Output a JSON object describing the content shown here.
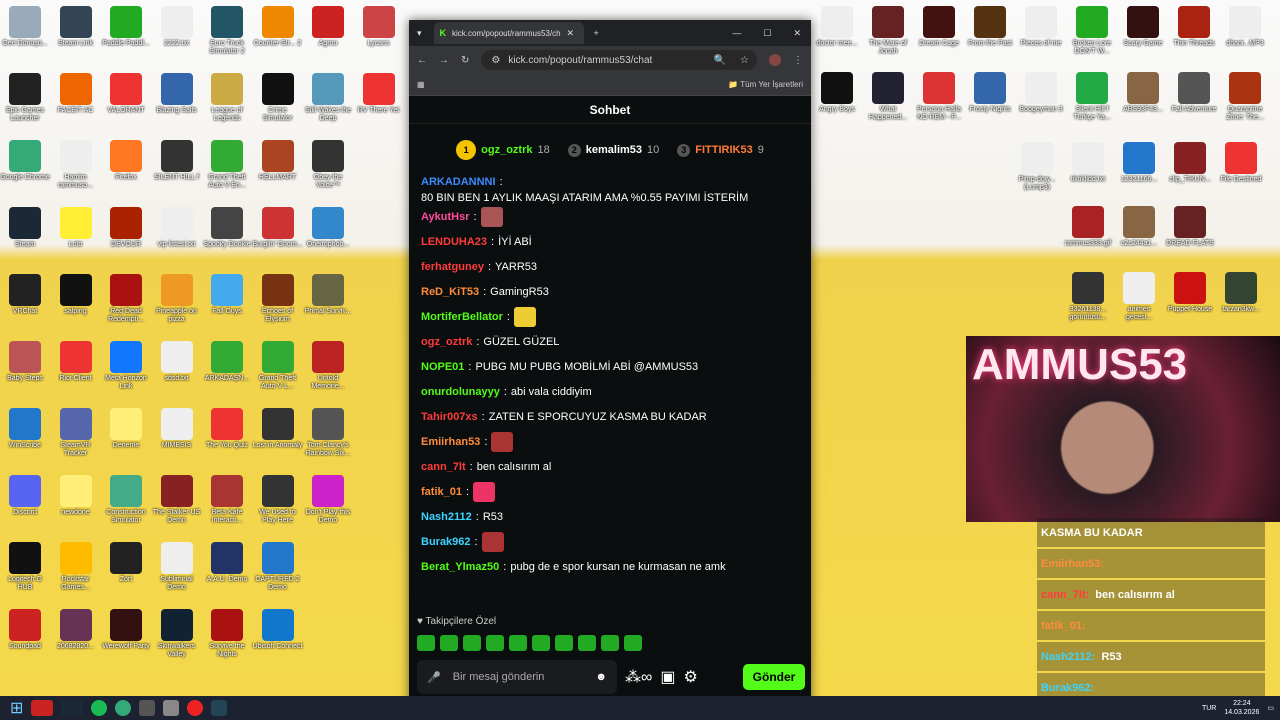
{
  "desktop_left": [
    [
      "Geri Dönüşü...",
      "#9ab"
    ],
    [
      "Steam Link",
      "#345"
    ],
    [
      "Paddle Paddl...",
      "#2a2"
    ],
    [
      "2222.txt",
      "#eee"
    ],
    [
      "Euro Truck Simulator 2",
      "#256"
    ],
    [
      "Counter-Str... 2",
      "#e80"
    ],
    [
      "Agrou",
      "#c22"
    ],
    [
      "Lycans",
      "#c44"
    ],
    [
      "Epic Games Launcher",
      "#222"
    ],
    [
      "FACEIT AC",
      "#e60"
    ],
    [
      "VALORANT",
      "#e33"
    ],
    [
      "Blazing Sails",
      "#36a"
    ],
    [
      "League of Legends",
      "#ca4"
    ],
    [
      "Crime Simulator",
      "#111"
    ],
    [
      "Still Wakes the Deep",
      "#59b"
    ],
    [
      "RV There Yet",
      "#e33"
    ],
    [
      "Google Chrome",
      "#3a7"
    ],
    [
      "Hamim rammuso...",
      "#eee"
    ],
    [
      "Firefox",
      "#f72"
    ],
    [
      "SILENT HILL f",
      "#333"
    ],
    [
      "Grand Theft Auto V En...",
      "#3a3"
    ],
    [
      "HELLMART",
      "#a42"
    ],
    [
      "Obey the Voice™",
      "#333"
    ],
    [
      "Steam",
      "#1b2838"
    ],
    [
      "Loto",
      "#fe3"
    ],
    [
      "DEVOUR",
      "#a20"
    ],
    [
      "vip listesi.txt",
      "#eee"
    ],
    [
      "Spooky Dookie",
      "#444"
    ],
    [
      "Burglin' Gnom...",
      "#c33"
    ],
    [
      "Oneirophob...",
      "#38c"
    ],
    [
      "VRChat",
      "#222"
    ],
    [
      "salping",
      "#111"
    ],
    [
      "Red Dead Redempti...",
      "#a11"
    ],
    [
      "Pineapple on pizza",
      "#e92"
    ],
    [
      "Fall Guys",
      "#4ae"
    ],
    [
      "Echoes of Elysium",
      "#731"
    ],
    [
      "Primal Surviv...",
      "#664"
    ],
    [
      "Baby Steps",
      "#b55"
    ],
    [
      "Riot Client",
      "#e33"
    ],
    [
      "Meta Horizon Link",
      "#17f"
    ],
    [
      "sdsd.txt",
      "#eee"
    ],
    [
      "ARKADAŞN...",
      "#3a3"
    ],
    [
      "Grand Theft Auto V L...",
      "#3a3"
    ],
    [
      "Untold Memorie...",
      "#b22"
    ],
    [
      "WinScribe",
      "#27c"
    ],
    [
      "SteamVR Tracker",
      "#56a"
    ],
    [
      "Deneme",
      "#fe7"
    ],
    [
      "MIMESIS",
      "#eee"
    ],
    [
      "The You Quiz",
      "#e33"
    ],
    [
      "Lost in Anomaly",
      "#333"
    ],
    [
      "Tom Clancy's Rainbow Six...",
      "#555"
    ],
    [
      "Discord",
      "#5865f2"
    ],
    [
      "newdone",
      "#fe7"
    ],
    [
      "Construction Simulator",
      "#4a8"
    ],
    [
      "The Stalker US Demo",
      "#822"
    ],
    [
      "Beta Kafe Interacti...",
      "#a33"
    ],
    [
      "We Used to Play Here",
      "#333"
    ],
    [
      "Don't Play this Demo",
      "#c2c"
    ],
    [
      "Logitech G HUB",
      "#111"
    ],
    [
      "Rockstar Games...",
      "#fb0"
    ],
    [
      "Zort",
      "#222"
    ],
    [
      "Subliminal Demo",
      "#eee"
    ],
    [
      "A.A.U. Demo",
      "#236"
    ],
    [
      "CAPTURED 2 Demo",
      "#27c"
    ],
    [
      "Soundpad",
      "#c22"
    ],
    [
      "20682820...",
      "#635"
    ],
    [
      "Werewolf Party",
      "#311"
    ],
    [
      "Skinwalkers Valley",
      "#123"
    ],
    [
      "Survive the Nights",
      "#a11"
    ],
    [
      "Ubisoft Connect",
      "#17c"
    ]
  ],
  "desktop_right": [
    [
      "doctor mee...",
      "#eee"
    ],
    [
      "The Mare of Jonah",
      "#622"
    ],
    [
      "Dream Cage",
      "#411"
    ],
    [
      "From the Past",
      "#531"
    ],
    [
      "Pieces of me",
      "#eee"
    ],
    [
      "Broken Lore DON'T W...",
      "#2a2"
    ],
    [
      "Scary Game",
      "#311"
    ],
    [
      "Thin Threads",
      "#a21"
    ],
    [
      "dhani...MP3",
      "#eee"
    ],
    [
      "Angry Boys",
      "#111"
    ],
    [
      "What Happened...",
      "#223"
    ],
    [
      "Persona Halla NO REM - P...",
      "#d33"
    ],
    [
      "Frosty Nights",
      "#36a"
    ],
    [
      "Boogeyman 3",
      "#eee"
    ],
    [
      "Silent Hill f Türkçe Ya...",
      "#2a4"
    ],
    [
      "ABS93F43...",
      "#864"
    ],
    [
      "Fall Adventure",
      "#555"
    ],
    [
      "Quarantine Zone: The...",
      "#a31"
    ],
    [
      "Pimp-dow... (Lump3)",
      "#eee"
    ],
    [
      "tiktiklidd.txt",
      "#eee"
    ],
    [
      "12321166...",
      "#27c"
    ],
    [
      "clip_TIKUN...",
      "#822"
    ],
    [
      "File Destined",
      "#e33"
    ],
    [
      "rammus333.gif",
      "#a22"
    ],
    [
      "c2c244a1...",
      "#864"
    ],
    [
      "DREAD FLATS",
      "#622"
    ],
    [
      "33261138... görüntüsü...",
      "#333"
    ],
    [
      "animes gecesi...",
      "#eee"
    ],
    [
      "Puppet House",
      "#c11"
    ],
    [
      "tarzan3kw...",
      "#343"
    ]
  ],
  "taskbar_time": "22:24",
  "taskbar_date": "14.03.2026",
  "taskbar_lang": "TUR",
  "browser": {
    "tab_title": "kick.com/popout/rammus53/ch",
    "url": "kick.com/popout/rammus53/chat",
    "bookmarks": "Tüm Yer İşaretleri"
  },
  "chat": {
    "header": "Sohbet",
    "leaders": [
      {
        "rank": "1",
        "name": "ogz_oztrk",
        "count": "18",
        "color": "#53fc18"
      },
      {
        "rank": "2",
        "name": "kemalim53",
        "count": "10",
        "color": "#fff"
      },
      {
        "rank": "3",
        "name": "FITTIRIK53",
        "count": "9",
        "color": "#ff7b3a"
      }
    ],
    "messages": [
      {
        "user": "ARKADANNNI",
        "color": "#3b8cff",
        "text": "80 BIN BEN 1 AYLIK MAAŞI ATARIM AMA %0.55 PAYIMI İSTERİM",
        "emote": ""
      },
      {
        "user": "AykutHsr",
        "color": "#ff4d9e",
        "text": "",
        "emote": "#a55"
      },
      {
        "user": "LENDUHA23",
        "color": "#ff3b3b",
        "text": "İYİ ABİ",
        "emote": ""
      },
      {
        "user": "ferhatguney",
        "color": "#ff3b3b",
        "text": "YARR53",
        "emote": ""
      },
      {
        "user": "ReD_KiT53",
        "color": "#ff8c3b",
        "text": "GamingR53",
        "emote": ""
      },
      {
        "user": "MortiferBellator",
        "color": "#53fc18",
        "text": "",
        "emote": "#ec3"
      },
      {
        "user": "ogz_oztrk",
        "color": "#ff3b3b",
        "text": "GÜZEL GÜZEL",
        "emote": ""
      },
      {
        "user": "NOPE01",
        "color": "#53fc18",
        "text": "PUBG MU PUBG MOBİLMİ ABİ @AMMUS53",
        "emote": ""
      },
      {
        "user": "onurdolunayyy",
        "color": "#53fc18",
        "text": "abi vala ciddiyim",
        "emote": ""
      },
      {
        "user": "Tahir007xs",
        "color": "#ff3b3b",
        "text": "ZATEN E SPORCUYUZ KASMA BU KADAR",
        "emote": ""
      },
      {
        "user": "Emiirhan53",
        "color": "#ff8c3b",
        "text": "",
        "emote": "#a33"
      },
      {
        "user": "cann_7lt",
        "color": "#ff3b3b",
        "text": "ben calısırım al",
        "emote": ""
      },
      {
        "user": "fatik_01",
        "color": "#ff8c3b",
        "text": "",
        "emote": "#e36"
      },
      {
        "user": "Nash2112",
        "color": "#3bd4ff",
        "text": "R53",
        "emote": ""
      },
      {
        "user": "Burak962",
        "color": "#3bd4ff",
        "text": "",
        "emote": "#a33"
      },
      {
        "user": "Berat_Ylmaz50",
        "color": "#53fc18",
        "text": "pubg de e spor kursan ne kurmasan ne amk",
        "emote": ""
      }
    ],
    "followers_only": "Takipçilere Özel",
    "input_placeholder": "Bir mesaj gönderin",
    "send": "Gönder"
  },
  "overlay": [
    {
      "user": "KASMA BU KADAR",
      "text": "",
      "color": "#fff"
    },
    {
      "user": "Emiirhan53:",
      "text": "",
      "color": "#ff8c3b"
    },
    {
      "user": "cann_7lt:",
      "text": "ben calısırım al",
      "color": "#ff3b3b"
    },
    {
      "user": "fatik_01:",
      "text": "",
      "color": "#ff8c3b"
    },
    {
      "user": "Nash2112:",
      "text": "R53",
      "color": "#3bd4ff"
    },
    {
      "user": "Burak962:",
      "text": "",
      "color": "#3bd4ff"
    }
  ],
  "cam_text": "AMMUS53"
}
